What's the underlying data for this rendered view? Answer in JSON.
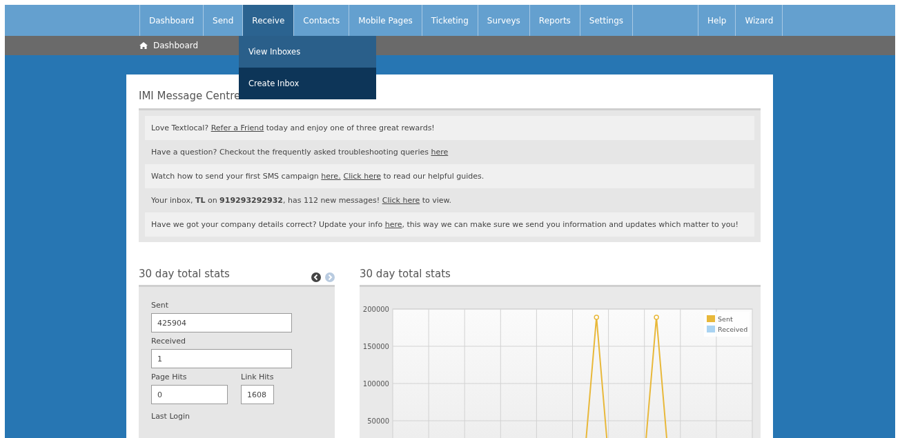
{
  "nav": {
    "items": [
      {
        "label": "Dashboard",
        "selected": false
      },
      {
        "label": "Send",
        "selected": false
      },
      {
        "label": "Receive",
        "selected": true
      },
      {
        "label": "Contacts",
        "selected": false
      },
      {
        "label": "Mobile Pages",
        "selected": false
      },
      {
        "label": "Ticketing",
        "selected": false
      },
      {
        "label": "Surveys",
        "selected": false
      },
      {
        "label": "Reports",
        "selected": false
      },
      {
        "label": "Settings",
        "selected": false
      },
      {
        "kind": "blank"
      },
      {
        "label": "Help",
        "selected": false
      },
      {
        "label": "Wizard",
        "selected": false
      }
    ],
    "dropdown": [
      {
        "label": "View Inboxes",
        "highlighted": true
      },
      {
        "label": "Create Inbox",
        "highlighted": false
      }
    ]
  },
  "breadcrumb": {
    "label": "Dashboard"
  },
  "title": "IMI Message Centre",
  "notices": [
    [
      {
        "kind": "text",
        "text": "Love Textlocal? "
      },
      {
        "kind": "link",
        "text": "Refer a Friend"
      },
      {
        "kind": "text",
        "text": " today and enjoy one of three great rewards!"
      }
    ],
    [
      {
        "kind": "text",
        "text": "Have a question? Checkout the frequently asked troubleshooting queries "
      },
      {
        "kind": "link",
        "text": "here"
      }
    ],
    [
      {
        "kind": "text",
        "text": "Watch how to send your first SMS campaign "
      },
      {
        "kind": "link",
        "text": "here."
      },
      {
        "kind": "link",
        "text": "Click here"
      },
      {
        "kind": "text",
        "text": " to read our helpful guides."
      }
    ],
    [
      {
        "kind": "text",
        "text": "Your inbox, "
      },
      {
        "kind": "bold",
        "text": "TL"
      },
      {
        "kind": "text",
        "text": " on "
      },
      {
        "kind": "bold",
        "text": "919293292932"
      },
      {
        "kind": "text",
        "text": ", has 112 new messages! "
      },
      {
        "kind": "link",
        "text": "Click here"
      },
      {
        "kind": "text",
        "text": " to view."
      }
    ],
    [
      {
        "kind": "text",
        "text": "Have we got your company details correct? Update your info "
      },
      {
        "kind": "link",
        "text": "here"
      },
      {
        "kind": "text",
        "text": ", this way we can make sure we send you information and updates which matter to you!"
      }
    ]
  ],
  "stats": {
    "title": "30 day total stats",
    "rows": [
      [
        {
          "label": "Sent",
          "value": "425904"
        }
      ],
      [
        {
          "label": "Received",
          "value": "1"
        }
      ],
      [
        {
          "label": "Page Hits",
          "value": "0"
        },
        {
          "label": "Link Hits",
          "value": "1608"
        }
      ]
    ],
    "last_label": "Last Login"
  },
  "chart_panel": {
    "title": "30 day total stats",
    "chart_data": {
      "type": "line",
      "ylim": [
        0,
        200000
      ],
      "yticks": [
        50000,
        100000,
        150000,
        200000
      ],
      "grid": true,
      "legend": "upper right",
      "series": [
        {
          "name": "Sent",
          "color": "#e8b83a",
          "values": [
            null,
            null,
            null,
            null,
            null,
            null,
            null,
            null,
            null,
            null,
            null,
            null,
            null,
            null,
            null,
            null,
            0,
            189000,
            0,
            null,
            null,
            0,
            189000,
            0,
            null,
            null,
            null,
            null,
            null,
            null,
            null
          ]
        },
        {
          "name": "Received",
          "color": "#a9d3f2",
          "values": [
            null,
            null,
            null,
            null,
            null,
            null,
            null,
            null,
            null,
            null,
            null,
            null,
            null,
            null,
            null,
            null,
            null,
            null,
            null,
            null,
            null,
            null,
            null,
            null,
            null,
            null,
            null,
            null,
            null,
            null,
            null
          ]
        }
      ]
    }
  }
}
